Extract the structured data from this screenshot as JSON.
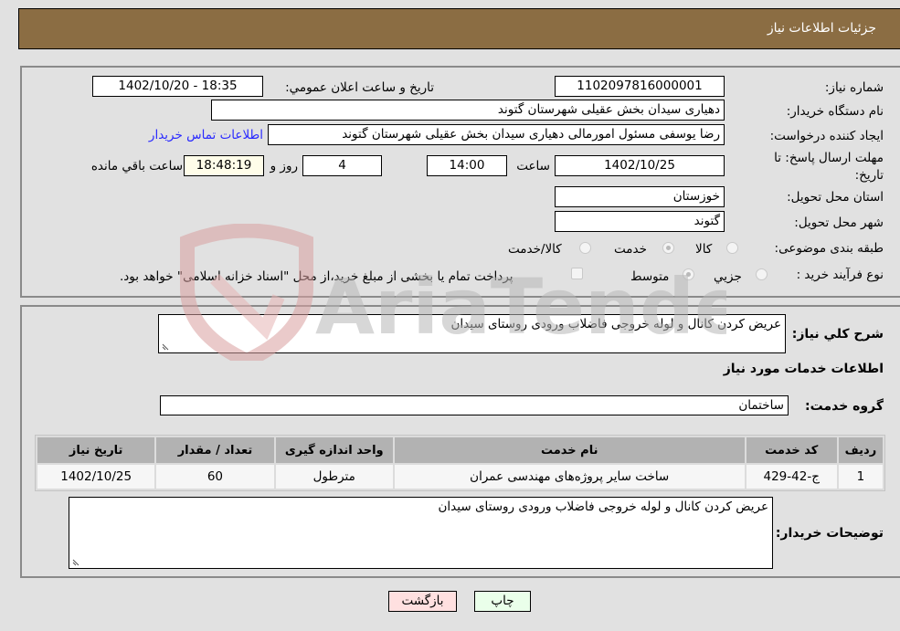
{
  "header": {
    "title": "جزئیات اطلاعات نیاز"
  },
  "form": {
    "need_number": {
      "label": "شماره نیاز:",
      "value": "1102097816000001"
    },
    "announce_datetime": {
      "label": "تاریخ و ساعت اعلان عمومي:",
      "value": "1402/10/20 - 18:35"
    },
    "buyer_org": {
      "label": "نام دستگاه خریدار:",
      "value": "دهیاری سیدان بخش عقیلی شهرستان گتوند"
    },
    "requester": {
      "label": "ایجاد کننده درخواست:",
      "value": "رضا یوسفی مسئول امورمالی دهیاری سیدان بخش عقیلی شهرستان گتوند"
    },
    "contact_link": "اطلاعات تماس خریدار",
    "deadline": {
      "label": "مهلت ارسال پاسخ: تا تاریخ:",
      "date": "1402/10/25",
      "time_label": "ساعت",
      "time": "14:00",
      "days": "4",
      "days_label": "روز و",
      "remaining": "18:48:19",
      "remaining_label": "ساعت باقي مانده"
    },
    "province": {
      "label": "استان محل تحویل:",
      "value": "خوزستان"
    },
    "city": {
      "label": "شهر محل تحویل:",
      "value": "گتوند"
    },
    "category": {
      "label": "طبقه بندی موضوعی:",
      "options": [
        "کالا",
        "خدمت",
        "کالا/خدمت"
      ],
      "selected": "خدمت"
    },
    "purchase_process": {
      "label": "نوع فرآیند خرید :",
      "options": [
        "جزيي",
        "متوسط"
      ],
      "selected": "متوسط",
      "treasury_note": "پرداخت تمام یا بخشی از مبلغ خرید،از محل \"اسناد خزانه اسلامی\" خواهد بود."
    }
  },
  "details": {
    "summary_label": "شرح کلي نیاز:",
    "summary_value": "عریض کردن کانال و لوله خروجی فاضلاب ورودی روستای سیدان",
    "services_heading": "اطلاعات خدمات مورد نیاز",
    "service_group_label": "گروه خدمت:",
    "service_group_value": "ساختمان",
    "table": {
      "headers": [
        "ردیف",
        "کد خدمت",
        "نام خدمت",
        "واحد اندازه گیری",
        "تعداد / مقدار",
        "تاریخ نیاز"
      ],
      "rows": [
        [
          "1",
          "ج-42-429",
          "ساخت سایر پروژه‌های مهندسی عمران",
          "مترطول",
          "60",
          "1402/10/25"
        ]
      ]
    },
    "buyer_notes_label": "توضیحات خریدار:",
    "buyer_notes_value": "عریض کردن کانال و لوله خروجی فاضلاب ورودی روستای سیدان"
  },
  "buttons": {
    "print": "چاپ",
    "back": "بازگشت"
  },
  "watermark": "AriaTender.neT",
  "colors": {
    "header_bg": "#8b6d43",
    "print_bg": "#eaffea",
    "back_bg": "#ffe0e0",
    "link": "#2a2aff"
  }
}
